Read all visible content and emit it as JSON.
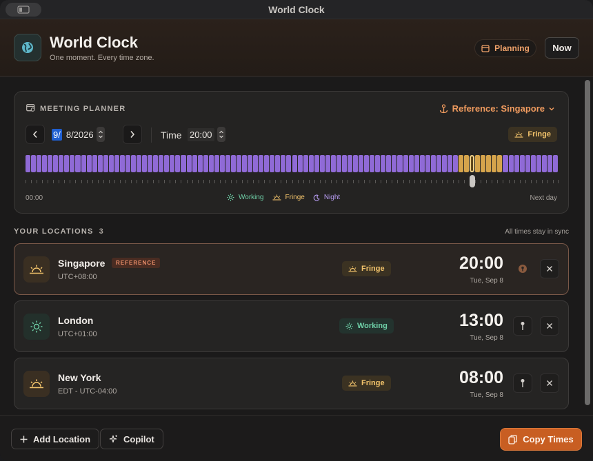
{
  "window": {
    "title": "World Clock"
  },
  "header": {
    "title": "World Clock",
    "subtitle": "One moment. Every time zone.",
    "planning_label": "Planning",
    "now_label": "Now"
  },
  "planner": {
    "heading": "MEETING PLANNER",
    "reference_label": "Reference: Singapore",
    "date_month": "9/",
    "date_rest": "8/2026",
    "time_label": "Time",
    "time_value": "20:00",
    "status_label": "Fringe",
    "scale_start": "00:00",
    "scale_end": "Next day",
    "legend": [
      {
        "label": "Working",
        "color": "#6fd0a8",
        "icon": "sun-icon"
      },
      {
        "label": "Fringe",
        "color": "#f2c36b",
        "icon": "sunrise-icon"
      },
      {
        "label": "Night",
        "color": "#b79cf2",
        "icon": "moon-icon"
      }
    ],
    "timeline": {
      "slots_per_day": 96,
      "fringe_slots": [
        78,
        86
      ],
      "selected_slot": 80,
      "colors": {
        "night": "#8f6ad6",
        "fringe": "#d5a44c",
        "selected": "#f0d28a"
      }
    }
  },
  "locations": {
    "heading": "YOUR LOCATIONS",
    "count": "3",
    "sync_note": "All times stay in sync",
    "items": [
      {
        "name": "Singapore",
        "badge": "REFERENCE",
        "tz": "UTC+08:00",
        "status": "Fringe",
        "status_icon": "sunrise-icon",
        "time": "20:00",
        "date": "Tue, Sep 8",
        "reference": true
      },
      {
        "name": "London",
        "badge": "",
        "tz": "UTC+01:00",
        "status": "Working",
        "status_icon": "sun-icon",
        "time": "13:00",
        "date": "Tue, Sep 8",
        "reference": false
      },
      {
        "name": "New York",
        "badge": "",
        "tz": "EDT - UTC-04:00",
        "status": "Fringe",
        "status_icon": "sunrise-icon",
        "time": "08:00",
        "date": "Tue, Sep 8",
        "reference": false
      }
    ]
  },
  "footer": {
    "add_location_label": "Add Location",
    "copilot_label": "Copilot",
    "copy_times_label": "Copy Times"
  },
  "colors": {
    "accent": "#c85e22",
    "working": "#6fd0a8",
    "fringe": "#f2c36b",
    "night": "#8f6ad6"
  }
}
